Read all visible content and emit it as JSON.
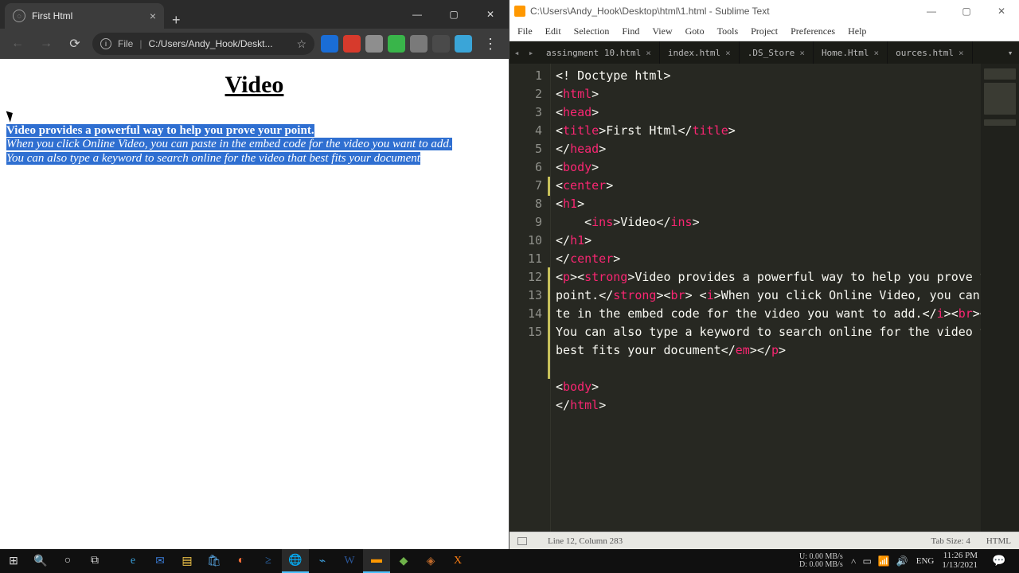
{
  "chrome": {
    "tab_title": "First Html",
    "omnibox": {
      "file_label": "File",
      "url": "C:/Users/Andy_Hook/Deskt..."
    },
    "page": {
      "heading": "Video",
      "p_strong": "Video provides a powerful way to help you prove your point.",
      "p_italic1": "When you click Online Video, you can paste in the embed code for the video you want to add.",
      "p_italic2": "You can also type a keyword to search online for the video that best fits your document"
    }
  },
  "sublime": {
    "title": "C:\\Users\\Andy_Hook\\Desktop\\html\\1.html - Sublime Text",
    "menu": [
      "File",
      "Edit",
      "Selection",
      "Find",
      "View",
      "Goto",
      "Tools",
      "Project",
      "Preferences",
      "Help"
    ],
    "tabs": [
      "assingment 10.html",
      "index.html",
      ".DS_Store",
      "Home.Html",
      "ources.html"
    ],
    "code_lines": [
      [
        [
          "pun",
          "<! "
        ],
        [
          "txt",
          "Doctype html"
        ],
        [
          "pun",
          ">"
        ]
      ],
      [
        [
          "pun",
          "<"
        ],
        [
          "tag",
          "html"
        ],
        [
          "pun",
          ">"
        ]
      ],
      [
        [
          "pun",
          "<"
        ],
        [
          "tag",
          "head"
        ],
        [
          "pun",
          ">"
        ]
      ],
      [
        [
          "pun",
          "<"
        ],
        [
          "tag",
          "title"
        ],
        [
          "pun",
          ">"
        ],
        [
          "txt",
          "First Html"
        ],
        [
          "pun",
          "</"
        ],
        [
          "tag",
          "title"
        ],
        [
          "pun",
          ">"
        ]
      ],
      [
        [
          "pun",
          "</"
        ],
        [
          "tag",
          "head"
        ],
        [
          "pun",
          ">"
        ]
      ],
      [
        [
          "pun",
          "<"
        ],
        [
          "tag",
          "body"
        ],
        [
          "pun",
          ">"
        ]
      ],
      [
        [
          "pun",
          "<"
        ],
        [
          "tag",
          "center"
        ],
        [
          "pun",
          ">"
        ]
      ],
      [
        [
          "pun",
          "<"
        ],
        [
          "tag",
          "h1"
        ],
        [
          "pun",
          ">"
        ]
      ],
      [
        [
          "txt",
          "    "
        ],
        [
          "pun",
          "<"
        ],
        [
          "tag",
          "ins"
        ],
        [
          "pun",
          ">"
        ],
        [
          "txt",
          "Video"
        ],
        [
          "pun",
          "</"
        ],
        [
          "tag",
          "ins"
        ],
        [
          "pun",
          ">"
        ]
      ],
      [
        [
          "pun",
          "</"
        ],
        [
          "tag",
          "h1"
        ],
        [
          "pun",
          ">"
        ]
      ],
      [
        [
          "pun",
          "</"
        ],
        [
          "tag",
          "center"
        ],
        [
          "pun",
          ">"
        ]
      ],
      [
        [
          "pun",
          "<"
        ],
        [
          "tag",
          "p"
        ],
        [
          "pun",
          "><"
        ],
        [
          "tag",
          "strong"
        ],
        [
          "pun",
          ">"
        ],
        [
          "txt",
          "Video provides a powerful way to help you prove your point."
        ],
        [
          "pun",
          "</"
        ],
        [
          "tag",
          "strong"
        ],
        [
          "pun",
          "><"
        ],
        [
          "tag",
          "br"
        ],
        [
          "pun",
          "> <"
        ],
        [
          "tag",
          "i"
        ],
        [
          "pun",
          ">"
        ],
        [
          "txt",
          "When you click Online Video, you can paste in the embed code for the video you want to add."
        ],
        [
          "pun",
          "</"
        ],
        [
          "tag",
          "i"
        ],
        [
          "pun",
          "><"
        ],
        [
          "tag",
          "br"
        ],
        [
          "pun",
          "><"
        ],
        [
          "tag",
          "em"
        ],
        [
          "pun",
          ">"
        ],
        [
          "txt",
          "You can also type a keyword to search online for the video that best fits your document"
        ],
        [
          "pun",
          "</"
        ],
        [
          "tag",
          "em"
        ],
        [
          "pun",
          "></"
        ],
        [
          "tag",
          "p"
        ],
        [
          "pun",
          ">"
        ]
      ],
      [],
      [
        [
          "pun",
          "<"
        ],
        [
          "tag",
          "body"
        ],
        [
          "pun",
          ">"
        ]
      ],
      [
        [
          "pun",
          "</"
        ],
        [
          "tag",
          "html"
        ],
        [
          "pun",
          ">"
        ]
      ]
    ],
    "status": {
      "pos": "Line 12, Column 283",
      "tabsize": "Tab Size: 4",
      "lang": "HTML"
    }
  },
  "taskbar": {
    "net_up": "0.00 MB/s",
    "net_down": "0.00 MB/s",
    "lang": "ENG",
    "time": "11:26 PM",
    "date": "1/13/2021"
  },
  "ext_colors": [
    "#1a6dd6",
    "#d73a2c",
    "#8e8e8e",
    "#39b54a",
    "#7a7a7a",
    "#4a4a4a",
    "#3aa5d8"
  ]
}
